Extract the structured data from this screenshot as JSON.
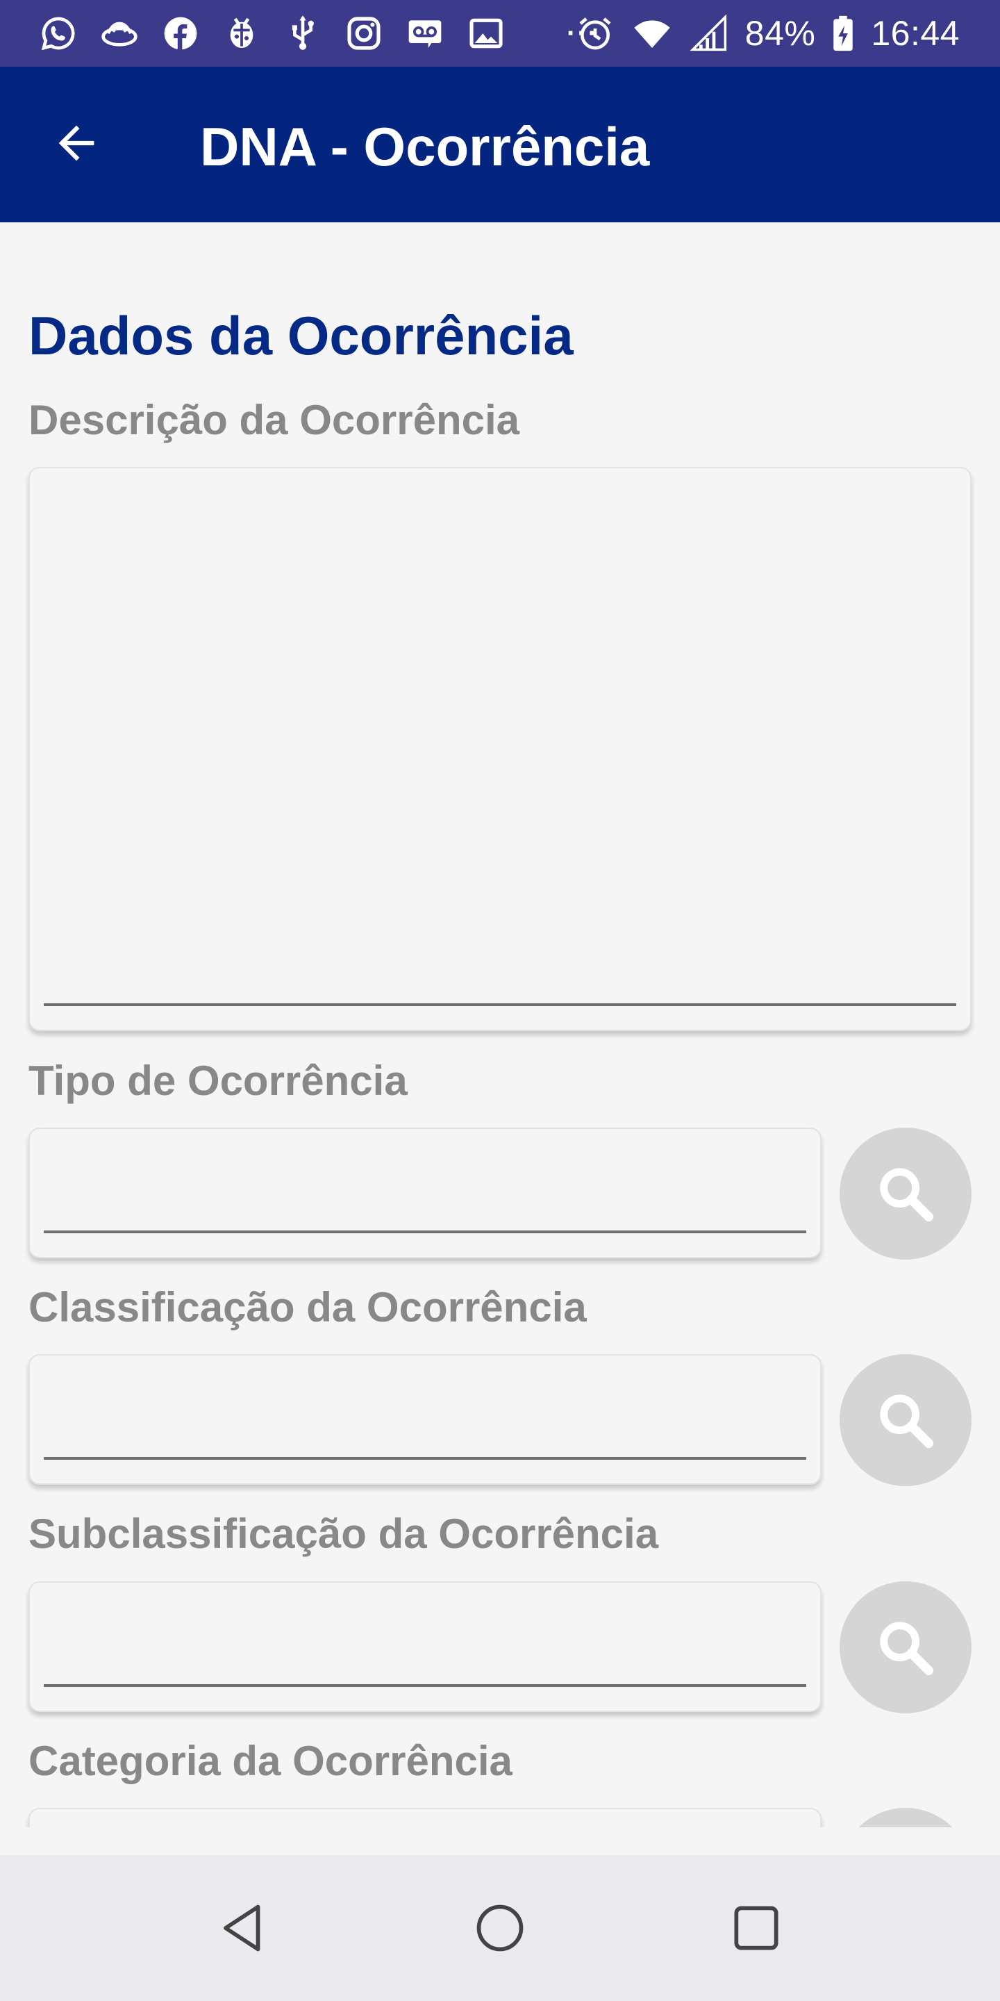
{
  "status_bar": {
    "icons": [
      "whatsapp-icon",
      "bank-icon",
      "facebook-icon",
      "bug-icon",
      "usb-icon",
      "instagram-icon",
      "voicemail-icon",
      "image-icon"
    ],
    "more": "···",
    "battery_percent": "84%",
    "time": "16:44"
  },
  "app_bar": {
    "title": "DNA - Ocorrência",
    "back_icon": "arrow-back-icon"
  },
  "form": {
    "section_title": "Dados da Ocorrência",
    "description": {
      "label": "Descrição da Ocorrência",
      "value": ""
    },
    "tipo": {
      "label": "Tipo de Ocorrência",
      "value": "",
      "search_icon": "search-icon"
    },
    "classificacao": {
      "label": "Classificação da Ocorrência",
      "value": "",
      "search_icon": "search-icon"
    },
    "subclassificacao": {
      "label": "Subclassificação da Ocorrência",
      "value": "",
      "search_icon": "search-icon"
    },
    "categoria": {
      "label": "Categoria da Ocorrência",
      "value": "",
      "search_icon": "search-icon"
    }
  },
  "nav_bar": {
    "icons": [
      "back-triangle-icon",
      "home-circle-icon",
      "recents-square-icon"
    ]
  },
  "colors": {
    "status_bar": "#3c3a8a",
    "app_bar": "#03247f",
    "section_title": "#052a86",
    "label": "#888888",
    "search_button": "#d5d5d5"
  }
}
